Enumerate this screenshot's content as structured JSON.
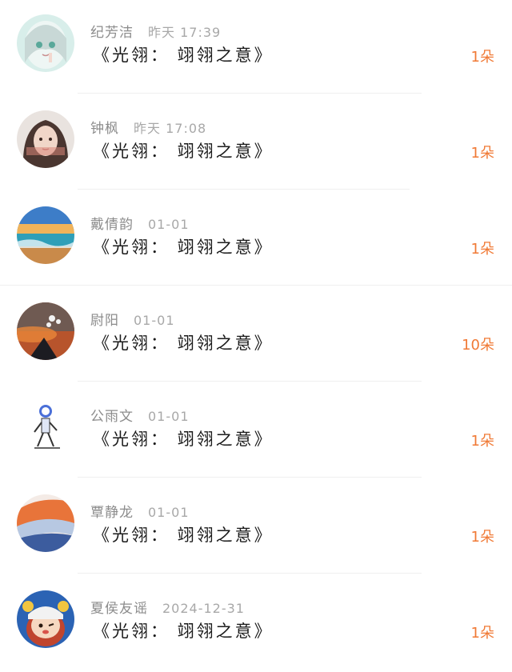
{
  "comments": [
    {
      "name": "纪芳洁",
      "time": "昨天 17:39",
      "title": "《光翎：   翊翎之意》",
      "count": "1朵",
      "avatar": "anime-girl"
    },
    {
      "name": "钟枫",
      "time": "昨天 17:08",
      "title": "《光翎：   翊翎之意》",
      "count": "1朵",
      "avatar": "girl-photo"
    },
    {
      "name": "戴倩韵",
      "time": "01-01",
      "title": "《光翎：   翊翎之意》",
      "count": "1朵",
      "avatar": "ocean-sunset"
    },
    {
      "name": "尉阳",
      "time": "01-01",
      "title": "《光翎：   翊翎之意》",
      "count": "10朵",
      "avatar": "mountain-sunset"
    },
    {
      "name": "公雨文",
      "time": "01-01",
      "title": "《光翎：   翊翎之意》",
      "count": "1朵",
      "avatar": "cartoon-figure"
    },
    {
      "name": "覃静龙",
      "time": "01-01",
      "title": "《光翎：   翊翎之意》",
      "count": "1朵",
      "avatar": "abstract-orange"
    },
    {
      "name": "夏侯友谣",
      "time": "2024-12-31",
      "title": "《光翎：   翊翎之意》",
      "count": "1朵",
      "avatar": "cartoon-face"
    }
  ],
  "colors": {
    "accent": "#f07a36",
    "name": "#8c8c8c",
    "title": "#1a1a1a"
  }
}
